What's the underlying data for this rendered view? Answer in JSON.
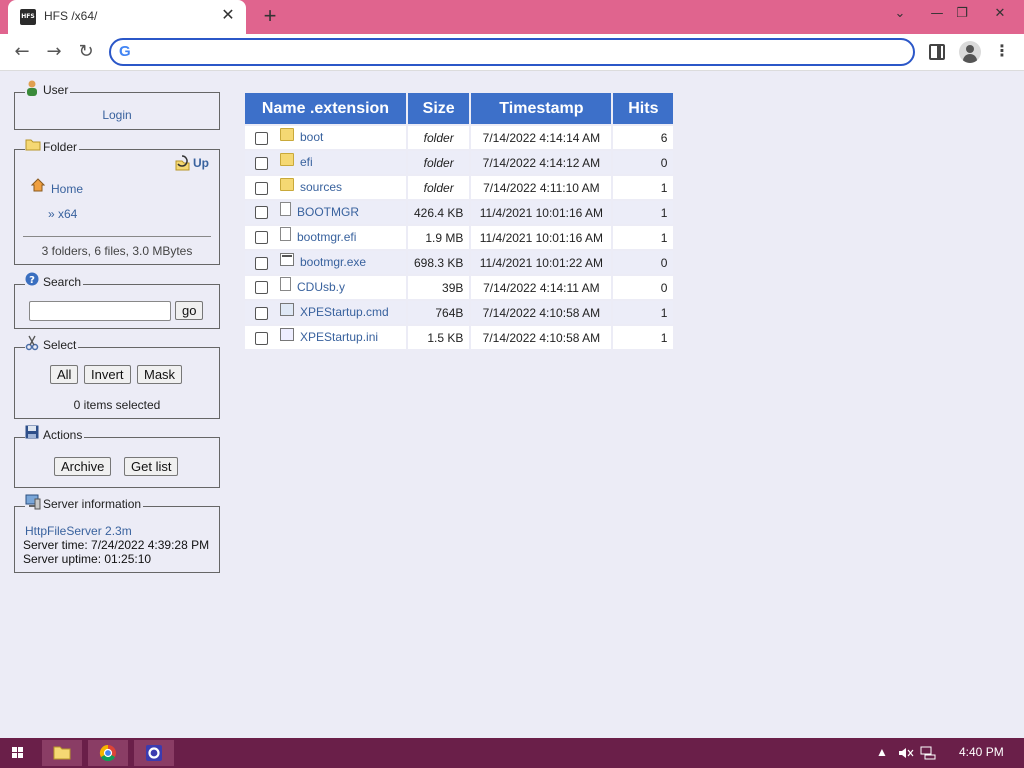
{
  "browser": {
    "tab_title": "HFS /x64/",
    "favicon_text": "HFS",
    "tab_close": "✕",
    "new_tab": "+",
    "window_buttons": {
      "chevron": "⌄",
      "minimize": "—",
      "restore": "❐",
      "close": "✕"
    },
    "nav": {
      "back": "←",
      "forward": "→",
      "reload": "↻",
      "menu": "⋮"
    },
    "omnibox": {
      "google_glyph": "G",
      "value": "",
      "placeholder": ""
    }
  },
  "user_panel": {
    "legend": "User",
    "login": "Login"
  },
  "folder_panel": {
    "legend": "Folder",
    "up": "Up",
    "home": "Home",
    "current": "» x64",
    "summary": "3 folders, 6 files, 3.0 MBytes"
  },
  "search_panel": {
    "legend": "Search",
    "value": "",
    "go": "go"
  },
  "select_panel": {
    "legend": "Select",
    "all": "All",
    "invert": "Invert",
    "mask": "Mask",
    "status": "0 items selected"
  },
  "actions_panel": {
    "legend": "Actions",
    "archive": "Archive",
    "get_list": "Get list"
  },
  "server_panel": {
    "legend": "Server information",
    "link": "HttpFileServer 2.3m",
    "time": "Server time: 7/24/2022 4:39:28 PM",
    "uptime": "Server uptime: 01:25:10"
  },
  "file_table": {
    "headers": [
      "Name .extension",
      "Size",
      "Timestamp",
      "Hits"
    ],
    "rows": [
      {
        "name": "boot",
        "size": "folder",
        "timestamp": "7/14/2022 4:14:14 AM",
        "hits": "6",
        "icon": "folder-icon"
      },
      {
        "name": "efi",
        "size": "folder",
        "timestamp": "7/14/2022 4:14:12 AM",
        "hits": "0",
        "icon": "folder-icon"
      },
      {
        "name": "sources",
        "size": "folder",
        "timestamp": "7/14/2022 4:11:10 AM",
        "hits": "1",
        "icon": "folder-icon"
      },
      {
        "name": "BOOTMGR",
        "size": "426.4 KB",
        "timestamp": "11/4/2021 10:01:16 AM",
        "hits": "1",
        "icon": "file-icon"
      },
      {
        "name": "bootmgr.efi",
        "size": "1.9 MB",
        "timestamp": "11/4/2021 10:01:16 AM",
        "hits": "1",
        "icon": "file-icon"
      },
      {
        "name": "bootmgr.exe",
        "size": "698.3 KB",
        "timestamp": "11/4/2021 10:01:22 AM",
        "hits": "0",
        "icon": "exe-icon"
      },
      {
        "name": "CDUsb.y",
        "size": "39B",
        "timestamp": "7/14/2022 4:14:11 AM",
        "hits": "0",
        "icon": "file-icon"
      },
      {
        "name": "XPEStartup.cmd",
        "size": "764B",
        "timestamp": "7/14/2022 4:10:58 AM",
        "hits": "1",
        "icon": "cmd-icon"
      },
      {
        "name": "XPEStartup.ini",
        "size": "1.5 KB",
        "timestamp": "7/14/2022 4:10:58 AM",
        "hits": "1",
        "icon": "ini-icon"
      }
    ]
  },
  "taskbar": {
    "clock": "4:40 PM",
    "tray_up": "▲"
  }
}
